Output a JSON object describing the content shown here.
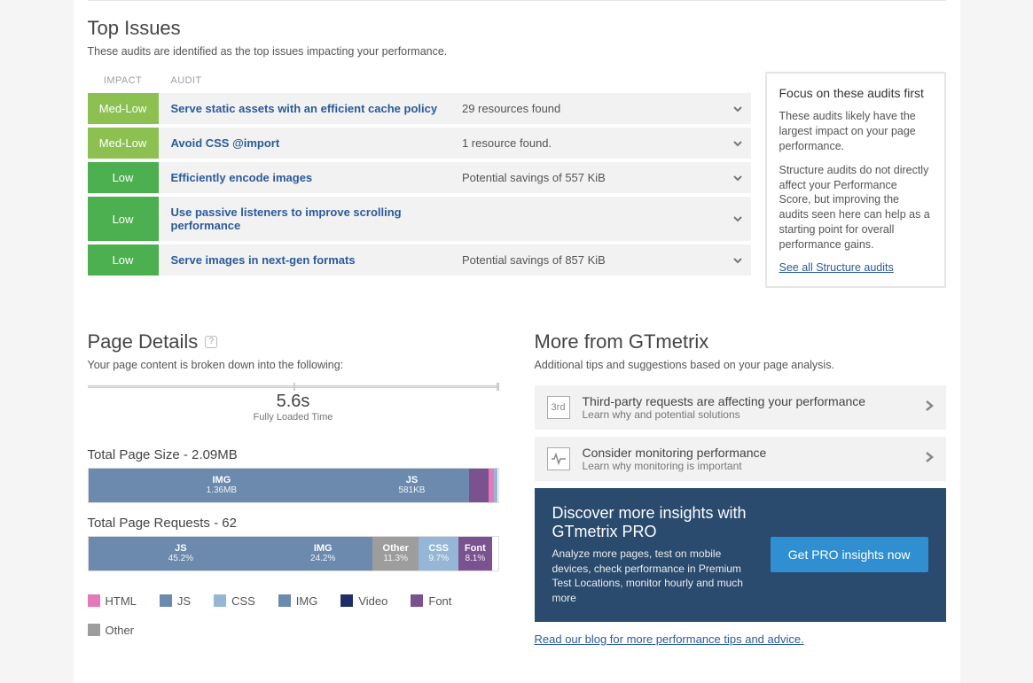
{
  "top_issues": {
    "title": "Top Issues",
    "desc": "These audits are identified as the top issues impacting your performance.",
    "header_impact": "IMPACT",
    "header_audit": "AUDIT",
    "rows": [
      {
        "impact": "Med-Low",
        "impact_class": "medlow",
        "audit": "Serve static assets with an efficient cache policy",
        "detail": "29 resources found"
      },
      {
        "impact": "Med-Low",
        "impact_class": "medlow",
        "audit": "Avoid CSS @import",
        "detail": "1 resource found."
      },
      {
        "impact": "Low",
        "impact_class": "low",
        "audit": "Efficiently encode images",
        "detail": "Potential savings of 557 KiB"
      },
      {
        "impact": "Low",
        "impact_class": "low",
        "audit": "Use passive listeners to improve scrolling performance",
        "detail": ""
      },
      {
        "impact": "Low",
        "impact_class": "low",
        "audit": "Serve images in next-gen formats",
        "detail": "Potential savings of 857 KiB"
      }
    ]
  },
  "focus": {
    "title": "Focus on these audits first",
    "p1": "These audits likely have the largest impact on your page performance.",
    "p2": "Structure audits do not directly affect your Performance Score, but improving the audits seen here can help as a starting point for overall performance gains.",
    "link": "See all Structure audits"
  },
  "page_details": {
    "title": "Page Details",
    "desc": "Your page content is broken down into the following:",
    "timeline_value": "5.6s",
    "timeline_label": "Fully Loaded Time",
    "size_title": "Total Page Size - 2.09MB",
    "requests_title": "Total Page Requests - 62"
  },
  "chart_data": [
    {
      "type": "bar",
      "orientation": "stacked-horizontal",
      "title": "Total Page Size - 2.09MB",
      "unit": "MB",
      "total": 2.09,
      "series": [
        {
          "name": "IMG",
          "label": "1.36MB",
          "value": 1.36,
          "pct": 65.1,
          "color": "#6b8aad"
        },
        {
          "name": "JS",
          "label": "581KB",
          "value": 0.581,
          "pct": 27.8,
          "color": "#6b8aad"
        },
        {
          "name": "Font",
          "label": "",
          "value": 0.1,
          "pct": 4.8,
          "color": "#7a528f"
        },
        {
          "name": "HTML",
          "label": "",
          "value": 0.03,
          "pct": 1.4,
          "color": "#e879b9"
        },
        {
          "name": "CSS",
          "label": "",
          "value": 0.02,
          "pct": 0.9,
          "color": "#95b6d6"
        }
      ]
    },
    {
      "type": "bar",
      "orientation": "stacked-horizontal",
      "title": "Total Page Requests - 62",
      "unit": "%",
      "total": 62,
      "series": [
        {
          "name": "JS",
          "label": "45.2%",
          "pct": 45.2,
          "color": "#6b8aad"
        },
        {
          "name": "IMG",
          "label": "24.2%",
          "pct": 24.2,
          "color": "#6b8aad"
        },
        {
          "name": "Other",
          "label": "11.3%",
          "pct": 11.3,
          "color": "#9d9d9d"
        },
        {
          "name": "CSS",
          "label": "9.7%",
          "pct": 9.7,
          "color": "#95b6d6"
        },
        {
          "name": "Font",
          "label": "8.1%",
          "pct": 8.1,
          "color": "#7a528f"
        }
      ]
    }
  ],
  "legend": [
    {
      "name": "HTML",
      "color": "#e879b9"
    },
    {
      "name": "JS",
      "color": "#6b8aad"
    },
    {
      "name": "CSS",
      "color": "#95b6d6"
    },
    {
      "name": "IMG",
      "color": "#6b8aad"
    },
    {
      "name": "Video",
      "color": "#1d2f66"
    },
    {
      "name": "Font",
      "color": "#7a528f"
    },
    {
      "name": "Other",
      "color": "#9d9d9d"
    }
  ],
  "more": {
    "title": "More from GTmetrix",
    "desc": "Additional tips and suggestions based on your page analysis.",
    "items": [
      {
        "icon": "3rd",
        "t1": "Third-party requests are affecting your performance",
        "t2": "Learn why and potential solutions"
      },
      {
        "icon": "pulse",
        "t1": "Consider monitoring performance",
        "t2": "Learn why monitoring is important"
      }
    ],
    "pro_title": "Discover more insights with GTmetrix PRO",
    "pro_desc": "Analyze more pages, test on mobile devices, check performance in Premium Test Locations, monitor hourly and much more",
    "pro_btn": "Get PRO insights now",
    "blog": "Read our blog for more performance tips and advice."
  }
}
